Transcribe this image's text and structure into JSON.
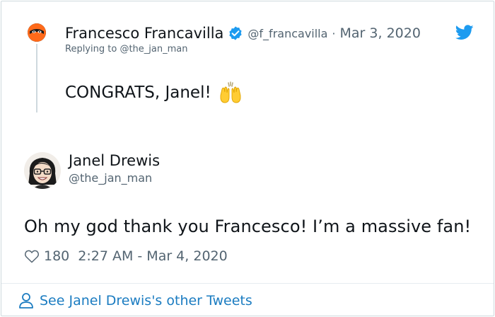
{
  "parent_tweet": {
    "author_name": "Francesco Francavilla",
    "author_handle": "@f_francavilla",
    "separator": "·",
    "date": "Mar 3, 2020",
    "replying_to_prefix": "Replying to",
    "replying_to_handle": "@the_jan_man",
    "text": "CONGRATS, Janel!",
    "emoji": "raising-hands"
  },
  "main_tweet": {
    "author_name": "Janel Drewis",
    "author_handle": "@the_jan_man",
    "text": "Oh my god thank you Francesco! I’m a massive fan!",
    "like_count": "180",
    "timestamp": "2:27 AM - Mar 4, 2020"
  },
  "footer": {
    "link_text": "See Janel Drewis's other Tweets"
  },
  "colors": {
    "text_primary": "#0f1419",
    "text_secondary": "#536471",
    "verified_blue": "#1d9bf0",
    "link_blue": "#1b7cc1",
    "twitter_blue": "#1d9bf0"
  }
}
